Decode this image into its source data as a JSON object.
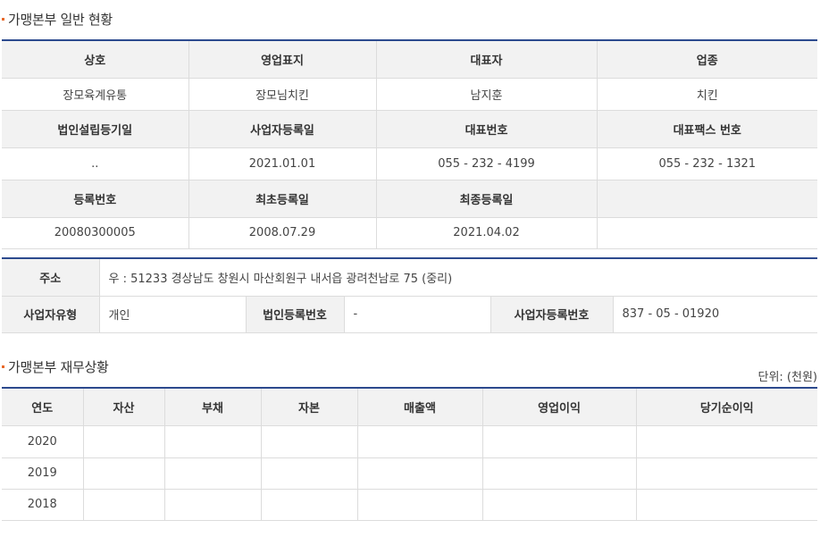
{
  "section1": {
    "title": "가맹본부 일반 현황",
    "headers_row1": [
      "상호",
      "영업표지",
      "대표자",
      "업종"
    ],
    "values_row1": [
      "장모육계유통",
      "장모님치킨",
      "남지훈",
      "치킨"
    ],
    "headers_row2": [
      "법인설립등기일",
      "사업자등록일",
      "대표번호",
      "대표팩스 번호"
    ],
    "values_row2": [
      "..",
      "2021.01.01",
      "055  -  232  -  4199",
      "055  -  232  -  1321"
    ],
    "headers_row3": [
      "등록번호",
      "최초등록일",
      "최종등록일",
      ""
    ],
    "values_row3": [
      "20080300005",
      "2008.07.29",
      "2021.04.02",
      ""
    ]
  },
  "address": {
    "label": "주소",
    "value": "우 : 51233 경상남도 창원시 마산회원구 내서읍 광려천남로 75 (중리)",
    "biz_type_label": "사업자유형",
    "biz_type_value": "개인",
    "corp_reg_label": "법인등록번호",
    "corp_reg_value": "-",
    "biz_reg_label": "사업자등록번호",
    "biz_reg_value": "837  -  05  -  01920"
  },
  "section2": {
    "title": "가맹본부 재무상황",
    "unit": "단위: (천원)",
    "headers": [
      "연도",
      "자산",
      "부채",
      "자본",
      "매출액",
      "영업이익",
      "당기순이익"
    ],
    "rows": [
      [
        "2020",
        "",
        "",
        "",
        "",
        "",
        ""
      ],
      [
        "2019",
        "",
        "",
        "",
        "",
        "",
        ""
      ],
      [
        "2018",
        "",
        "",
        "",
        "",
        "",
        ""
      ]
    ]
  },
  "colors": {
    "accent_line": "#2c4a8e",
    "bullet": "#e8692a",
    "header_bg": "#f2f2f2"
  }
}
